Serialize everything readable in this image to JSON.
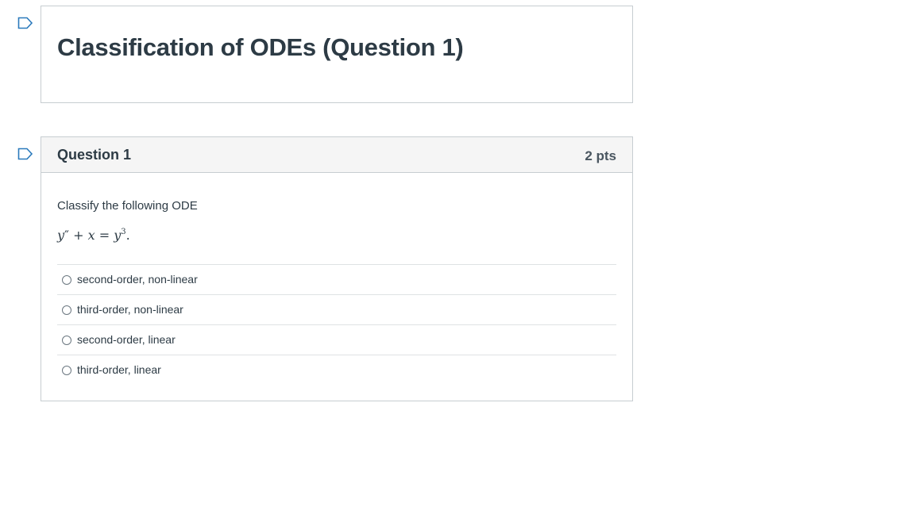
{
  "quiz": {
    "title": "Classification of ODEs (Question 1)"
  },
  "question": {
    "name": "Question 1",
    "points": "2 pts",
    "prompt": "Classify the following ODE",
    "equation": {
      "y": "y",
      "prime": "″",
      "plus": " + ",
      "x": "x",
      "equals": " = ",
      "y2": "y",
      "exp": "3",
      "end": "."
    },
    "answers": [
      {
        "label": "second-order, non-linear",
        "selected": false
      },
      {
        "label": "third-order, non-linear",
        "selected": false
      },
      {
        "label": "second-order, linear",
        "selected": false
      },
      {
        "label": "third-order, linear",
        "selected": false
      }
    ]
  },
  "icons": {
    "flag": "flag-question-icon",
    "radio": "radio-button-unchecked"
  },
  "colors": {
    "border": "#c7cdd1",
    "header_bg": "#f5f5f5",
    "text": "#2d3b45",
    "flag": "#2b7abc"
  }
}
